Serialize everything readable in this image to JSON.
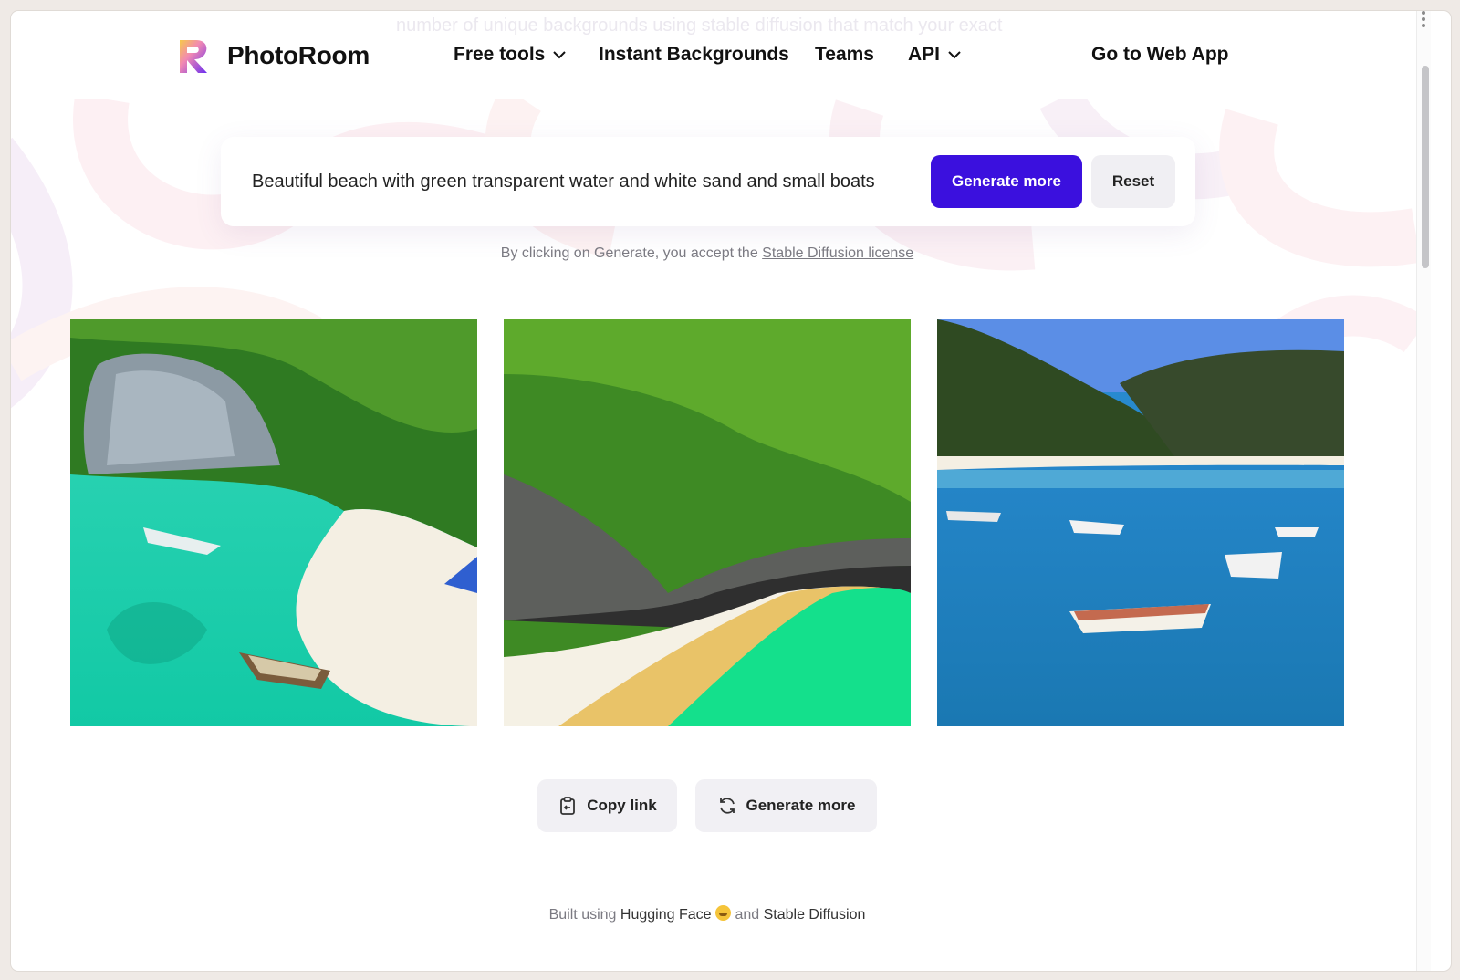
{
  "ghost_text": "number of unique backgrounds using stable diffusion that match your exact",
  "brand": {
    "name": "PhotoRoom",
    "colors": {
      "primary": "#3b10de",
      "logo_pink": "#f28ab2",
      "logo_purple": "#6b2ef0",
      "logo_yellow": "#f7c948"
    }
  },
  "nav": {
    "free_tools": "Free tools",
    "instant_backgrounds": "Instant Backgrounds",
    "teams": "Teams",
    "api": "API",
    "web_app": "Go to Web App"
  },
  "prompt": {
    "value": "Beautiful beach with green transparent water and white sand and small boats",
    "generate_label": "Generate more",
    "reset_label": "Reset"
  },
  "license": {
    "text": "By clicking on Generate, you accept the",
    "link": "Stable Diffusion license"
  },
  "images": [
    {
      "alt": "Turquoise bay with white rock cliff, green forest, sandy beach and small boats"
    },
    {
      "alt": "Green forested cliff above a white sand cove with emerald water"
    },
    {
      "alt": "Blue bay with forested hills and several small white boats"
    }
  ],
  "actions": {
    "copy_link": "Copy link",
    "generate_more": "Generate more"
  },
  "footer": {
    "built_using": "Built using",
    "hugging_face": "Hugging Face",
    "and": "and",
    "stable_diffusion": "Stable Diffusion"
  }
}
